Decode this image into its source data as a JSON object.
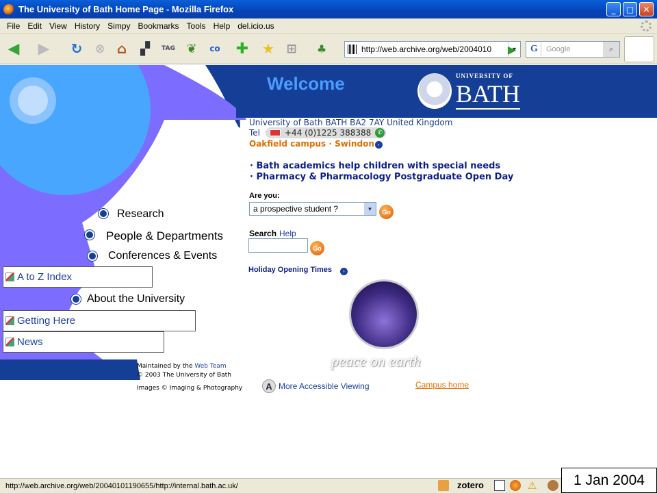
{
  "window": {
    "title": "The University of Bath Home Page - Mozilla Firefox"
  },
  "menu": [
    "File",
    "Edit",
    "View",
    "History",
    "Simpy",
    "Bookmarks",
    "Tools",
    "Help",
    "del.icio.us"
  ],
  "toolbar": {
    "url": "http://web.archive.org/web/2004010",
    "search_placeholder": "Google"
  },
  "header": {
    "welcome": "Welcome",
    "logo_small": "UNIVERSITY OF",
    "logo_big": "BATH"
  },
  "nav": {
    "research": "Research",
    "people": "People & Departments",
    "conferences": "Conferences & Events",
    "atoz": "A to Z Index",
    "about": "About the University",
    "getting_here": "Getting Here",
    "news": "News"
  },
  "address": {
    "line1": "University of Bath BATH BA2 7AY United Kingdom",
    "tel_label": "Tel",
    "tel": "+44 (0)1225 388388",
    "campus": "Oakfield campus · Swindon"
  },
  "news_items": [
    "· Bath academics help children with special needs",
    "· Pharmacy & Pharmacology Postgraduate Open Day"
  ],
  "form": {
    "are_you": "Are you:",
    "select_value": "a prospective student ?",
    "go": "Go",
    "search_label": "Search",
    "search_help": "Help",
    "holiday": "Holiday Opening Times"
  },
  "greeting": "peace on earth",
  "footer": {
    "maintained": "Maintained by the",
    "web_team": "Web Team",
    "copyright": "© 2003 The University of Bath",
    "images": "Images © Imaging & Photography",
    "accessible": "More Accessible Viewing",
    "campus_home": "Campus home"
  },
  "status": {
    "text": "http://web.archive.org/web/20040101190655/http://internal.bath.ac.uk/",
    "zotero": "zotero"
  },
  "date_label": "1 Jan 2004"
}
